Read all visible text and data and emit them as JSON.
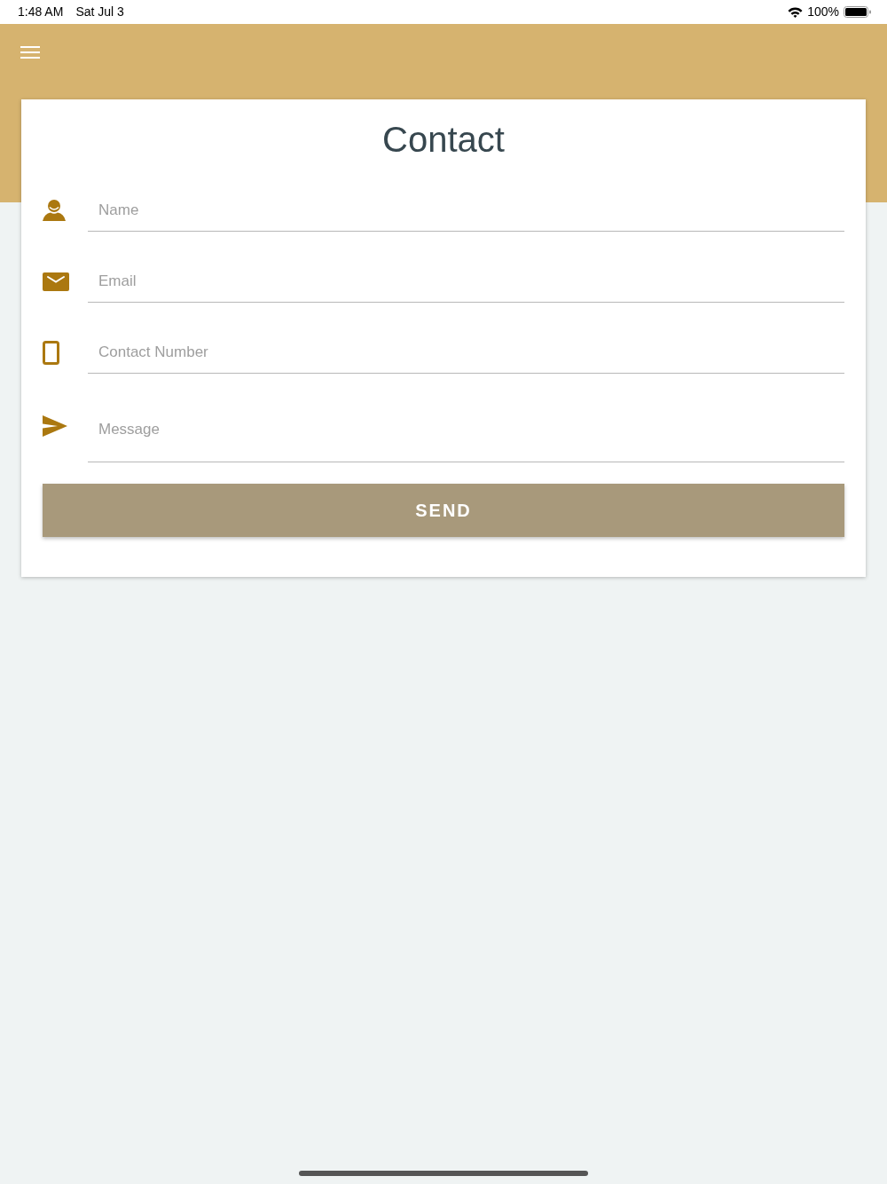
{
  "status_bar": {
    "time": "1:48 AM",
    "date": "Sat Jul 3",
    "battery": "100%"
  },
  "title": "Contact",
  "fields": [
    {
      "kind": "name",
      "placeholder": "Name"
    },
    {
      "kind": "email",
      "placeholder": "Email"
    },
    {
      "kind": "phone",
      "placeholder": "Contact Number"
    },
    {
      "kind": "message",
      "placeholder": "Message"
    }
  ],
  "send_button": {
    "label": "SEND"
  }
}
